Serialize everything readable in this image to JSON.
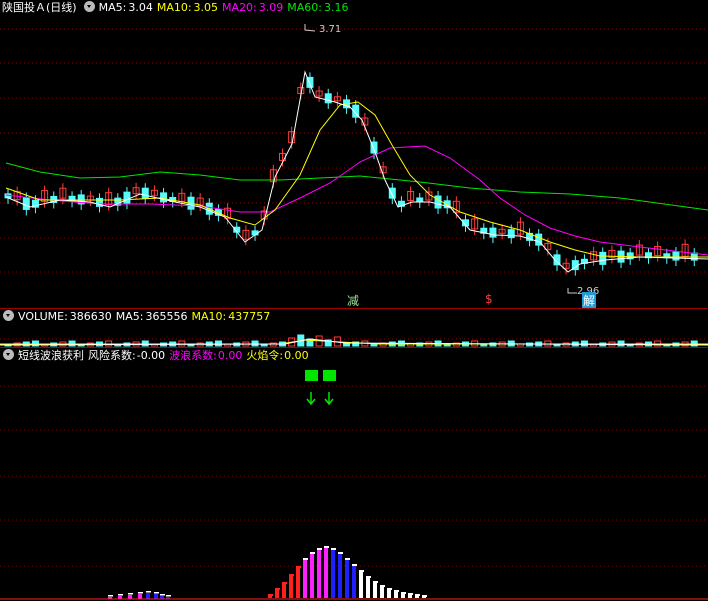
{
  "price_panel": {
    "stock_name": "陕国投Ａ",
    "period": "(日线)",
    "ma5_label": "MA5:",
    "ma5_value": "3.04",
    "ma10_label": "MA10:",
    "ma10_value": "3.05",
    "ma20_label": "MA20:",
    "ma20_value": "3.09",
    "ma60_label": "MA60:",
    "ma60_value": "3.16",
    "high_marker": "3.71",
    "low_marker": "2.96",
    "signal_jian": "减",
    "signal_s": "$",
    "signal_jie": "解"
  },
  "volume_panel": {
    "label": "VOLUME:",
    "value": "386630",
    "ma5_label": "MA5:",
    "ma5_value": "365556",
    "ma10_label": "MA10:",
    "ma10_value": "437757"
  },
  "indicator_panel": {
    "name": "短线波浪获利",
    "risk_label": "风险系数:",
    "risk_value": "-0.00",
    "wave_label": "波浪系数:",
    "wave_value": "0.00",
    "fire_label": "火焰令:",
    "fire_value": "0.00"
  },
  "colors": {
    "up": "#ff3c3c",
    "down": "#54fcfc",
    "ma5": "#ffffff",
    "ma10": "#ffff00",
    "ma20": "#ff00ff",
    "ma60": "#00e600",
    "grid": "#8b0000",
    "separator": "#a00000"
  }
}
